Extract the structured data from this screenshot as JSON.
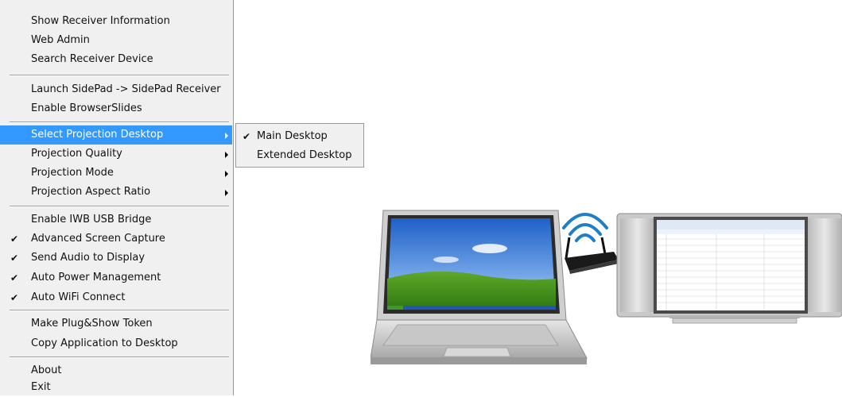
{
  "menu": {
    "items": [
      {
        "label": "Show Receiver Information",
        "checked": false,
        "submenu": false
      },
      {
        "label": "Web Admin",
        "checked": false,
        "submenu": false
      },
      {
        "label": "Search Receiver Device",
        "checked": false,
        "submenu": false
      },
      {
        "label": "Launch SidePad -> SidePad Receiver",
        "checked": false,
        "submenu": false
      },
      {
        "label": "Enable BrowserSlides",
        "checked": false,
        "submenu": false
      },
      {
        "label": "Select Projection Desktop",
        "checked": false,
        "submenu": true,
        "highlighted": true
      },
      {
        "label": "Projection Quality",
        "checked": false,
        "submenu": true
      },
      {
        "label": "Projection Mode",
        "checked": false,
        "submenu": true
      },
      {
        "label": "Projection Aspect Ratio",
        "checked": false,
        "submenu": true
      },
      {
        "label": "Enable IWB USB Bridge",
        "checked": false,
        "submenu": false
      },
      {
        "label": "Advanced Screen Capture",
        "checked": true,
        "submenu": false
      },
      {
        "label": "Send Audio to Display",
        "checked": true,
        "submenu": false
      },
      {
        "label": "Auto Power Management",
        "checked": true,
        "submenu": false
      },
      {
        "label": "Auto WiFi Connect",
        "checked": true,
        "submenu": false
      },
      {
        "label": "Make Plug&Show Token",
        "checked": false,
        "submenu": false
      },
      {
        "label": "Copy Application to Desktop",
        "checked": false,
        "submenu": false
      },
      {
        "label": "About",
        "checked": false,
        "submenu": false
      },
      {
        "label": "Exit",
        "checked": false,
        "submenu": false
      }
    ],
    "check_glyph": "✔"
  },
  "submenu": {
    "items": [
      {
        "label": "Main Desktop",
        "checked": true
      },
      {
        "label": "Extended Desktop",
        "checked": false
      }
    ]
  },
  "colors": {
    "menu_bg": "#f0f0f0",
    "highlight": "#3399ff",
    "wifi": "#1e7fc6"
  },
  "illustration": {
    "laptop": "laptop-icon",
    "router": "wireless-receiver-icon",
    "signal": "wifi-signal-icon",
    "display": "projector-display-icon"
  }
}
